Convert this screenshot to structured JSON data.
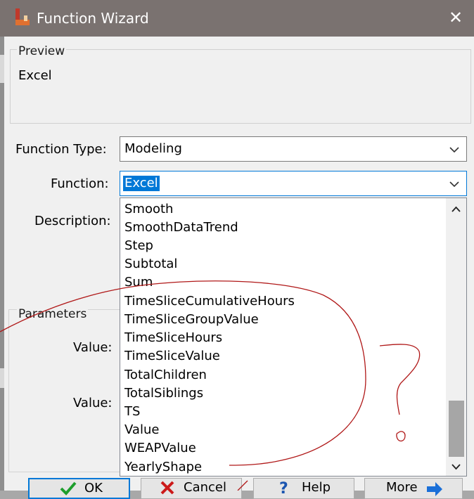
{
  "window": {
    "title": "Function Wizard"
  },
  "preview": {
    "group_label": "Preview",
    "value": "Excel"
  },
  "function_type": {
    "label": "Function Type:",
    "value": "Modeling"
  },
  "function": {
    "label": "Function:",
    "value": "Excel",
    "options": [
      "Smooth",
      "SmoothDataTrend",
      "Step",
      "Subtotal",
      "Sum",
      "TimeSliceCumulativeHours",
      "TimeSliceGroupValue",
      "TimeSliceHours",
      "TimeSliceValue",
      "TotalChildren",
      "TotalSiblings",
      "TS",
      "Value",
      "WEAPValue",
      "YearlyShape"
    ],
    "scroll_position": 0.85
  },
  "description": {
    "label": "Description:"
  },
  "parameters": {
    "group_label": "Parameters",
    "param_labels": [
      "Value:",
      "Value:"
    ]
  },
  "buttons": {
    "ok": "OK",
    "cancel": "Cancel",
    "help": "Help",
    "more": "More"
  },
  "colors": {
    "titlebar": "#7a7270",
    "accent": "#0078d7",
    "annotation_ink": "#b01818"
  },
  "icons": {
    "app": "weap-app-icon",
    "close": "close-icon",
    "ok": "check-icon",
    "cancel": "x-icon",
    "help": "question-icon",
    "more": "arrow-right-icon"
  }
}
